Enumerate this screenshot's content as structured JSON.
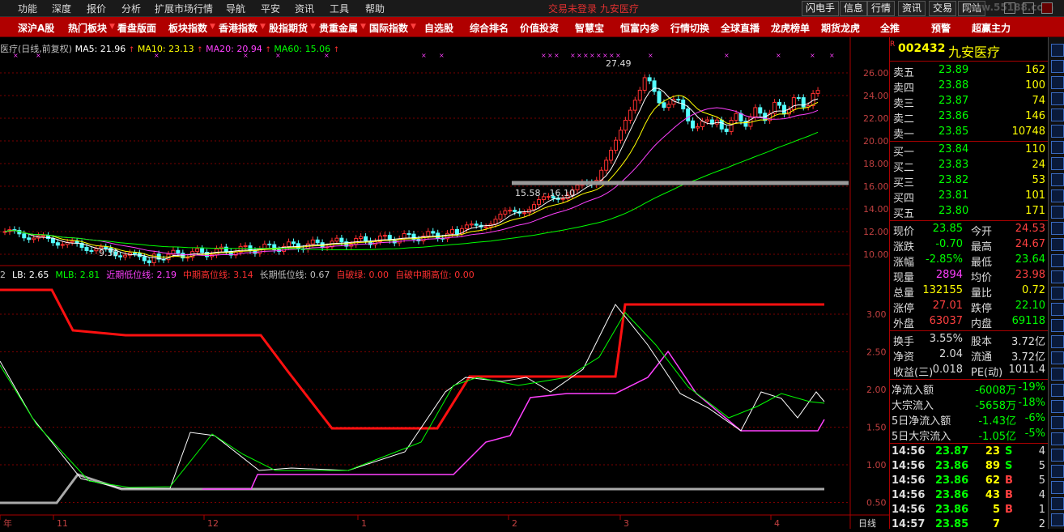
{
  "menu": {
    "items": [
      "功能",
      "深度",
      "报价",
      "分析",
      "扩展市场行情",
      "导航",
      "平安",
      "资讯",
      "工具",
      "帮助"
    ],
    "center_text": "交易未登录  九安医疗",
    "right_buttons": [
      "闪电手",
      "信息",
      "行情",
      "资讯",
      "交易",
      "网站"
    ],
    "watermark": "www.55188.com"
  },
  "toolbar": {
    "items": [
      "深沪A股",
      "热门板块",
      "看盘版面",
      "板块指数",
      "香港指数",
      "股指期货",
      "贵重金属",
      "国际指数",
      "自选股",
      "综合排名",
      "价值投资",
      "智慧宝",
      "恒富内参",
      "行情切换",
      "全球直播",
      "龙虎榜单",
      "期货龙虎",
      "全推",
      "预警",
      "超赢主力"
    ]
  },
  "top_chart": {
    "title": "医疗(日线,前复权)",
    "legend": [
      {
        "label": "MA5: 21.96",
        "color": "#ffffff"
      },
      {
        "label": "MA10: 23.13",
        "color": "#ffff00"
      },
      {
        "label": "MA20: 20.94",
        "color": "#ff40ff"
      },
      {
        "label": "MA60: 15.06",
        "color": "#00ff00"
      }
    ],
    "annotations": {
      "high": "27.49",
      "low": "9.30",
      "band": "15.58 - 16.10"
    },
    "y_ticks": [
      "26.00",
      "24.00",
      "22.00",
      "20.00",
      "18.00",
      "16.00",
      "14.00",
      "12.00",
      "10.00"
    ]
  },
  "bottom_chart": {
    "legend": [
      {
        "label": "2",
        "color": "#c0c0c0"
      },
      {
        "label": "LB: 2.65",
        "color": "#ffffff"
      },
      {
        "label": "MLB: 2.81",
        "color": "#00ff00"
      },
      {
        "label": "近期低位线: 2.19",
        "color": "#ff40ff"
      },
      {
        "label": "中期高位线: 3.14",
        "color": "#ff3030"
      },
      {
        "label": "长期低位线: 0.67",
        "color": "#c0c0c0"
      },
      {
        "label": "自破绿: 0.00",
        "color": "#ff3030"
      },
      {
        "label": "自破中期高位: 0.00",
        "color": "#ff3030"
      }
    ],
    "y_ticks": [
      "3.00",
      "2.50",
      "2.00",
      "1.50",
      "1.00",
      "0.50"
    ]
  },
  "x_axis": {
    "labels": [
      "年",
      "11",
      "12",
      "1",
      "2",
      "3",
      "4"
    ],
    "period": "日线"
  },
  "panel": {
    "code": "002432",
    "name": "九安医疗",
    "r_mark": "R",
    "asks": [
      {
        "label": "卖五",
        "price": "23.89",
        "vol": "162"
      },
      {
        "label": "卖四",
        "price": "23.88",
        "vol": "100"
      },
      {
        "label": "卖三",
        "price": "23.87",
        "vol": "74"
      },
      {
        "label": "卖二",
        "price": "23.86",
        "vol": "146"
      },
      {
        "label": "卖一",
        "price": "23.85",
        "vol": "10748"
      }
    ],
    "bids": [
      {
        "label": "买一",
        "price": "23.84",
        "vol": "110"
      },
      {
        "label": "买二",
        "price": "23.83",
        "vol": "24"
      },
      {
        "label": "买三",
        "price": "23.82",
        "vol": "53"
      },
      {
        "label": "买四",
        "price": "23.81",
        "vol": "101"
      },
      {
        "label": "买五",
        "price": "23.80",
        "vol": "171"
      }
    ],
    "quote": [
      {
        "l1": "现价",
        "v1": "23.85",
        "c1": "#00ff00",
        "l2": "今开",
        "v2": "24.53",
        "c2": "#ff4040"
      },
      {
        "l1": "涨跌",
        "v1": "-0.70",
        "c1": "#00ff00",
        "l2": "最高",
        "v2": "24.67",
        "c2": "#ff4040"
      },
      {
        "l1": "涨幅",
        "v1": "-2.85%",
        "c1": "#00ff00",
        "l2": "最低",
        "v2": "23.64",
        "c2": "#00ff00"
      },
      {
        "l1": "现量",
        "v1": "2894",
        "c1": "#ff40ff",
        "l2": "均价",
        "v2": "23.98",
        "c2": "#ff4040"
      },
      {
        "l1": "总量",
        "v1": "132155",
        "c1": "#ffff00",
        "l2": "量比",
        "v2": "0.72",
        "c2": "#ffff00"
      },
      {
        "l1": "涨停",
        "v1": "27.01",
        "c1": "#ff4040",
        "l2": "跌停",
        "v2": "22.10",
        "c2": "#00ff00"
      },
      {
        "l1": "外盘",
        "v1": "63037",
        "c1": "#ff4040",
        "l2": "内盘",
        "v2": "69118",
        "c2": "#00ff00"
      }
    ],
    "fund": [
      {
        "l1": "换手",
        "v1": "3.55%",
        "l2": "股本",
        "v2": "3.72亿"
      },
      {
        "l1": "净资",
        "v1": "2.04",
        "l2": "流通",
        "v2": "3.72亿"
      },
      {
        "l1": "收益(三)",
        "v1": "0.018",
        "l2": "PE(动)",
        "v2": "1011.4"
      }
    ],
    "flow": [
      {
        "label": "净流入额",
        "value": "-6008万",
        "pct": "-19%"
      },
      {
        "label": "大宗流入",
        "value": "-5658万",
        "pct": "-18%"
      },
      {
        "label": "5日净流入额",
        "value": "-1.43亿",
        "pct": "-6%"
      },
      {
        "label": "5日大宗流入",
        "value": "-1.05亿",
        "pct": "-5%"
      }
    ],
    "ticks": [
      {
        "time": "14:56",
        "price": "23.87",
        "vol": "23",
        "side": "S",
        "n": "4"
      },
      {
        "time": "14:56",
        "price": "23.86",
        "vol": "89",
        "side": "S",
        "n": "5"
      },
      {
        "time": "14:56",
        "price": "23.86",
        "vol": "62",
        "side": "B",
        "n": "5"
      },
      {
        "time": "14:56",
        "price": "23.86",
        "vol": "43",
        "side": "B",
        "n": "4"
      },
      {
        "time": "14:56",
        "price": "23.86",
        "vol": "5",
        "side": "B",
        "n": "1"
      },
      {
        "time": "14:57",
        "price": "23.85",
        "vol": "7",
        "side": "",
        "n": "2"
      }
    ]
  }
}
